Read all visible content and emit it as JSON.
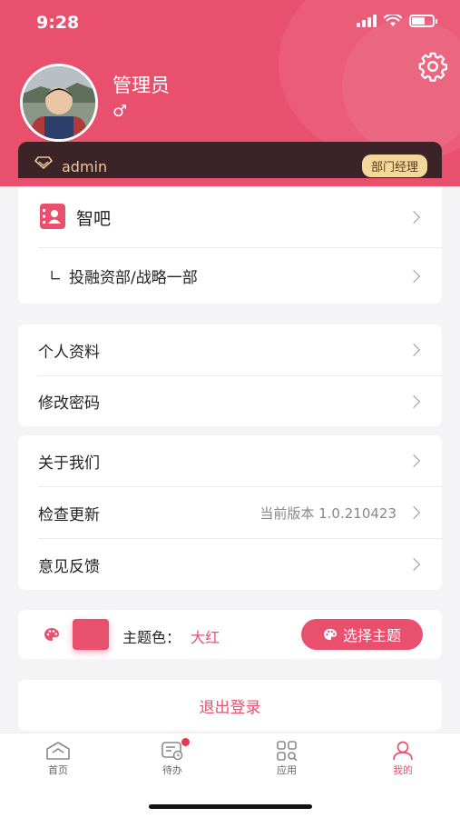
{
  "status_bar": {
    "time": "9:28"
  },
  "profile": {
    "name": "管理员",
    "gender_symbol": "♂"
  },
  "member": {
    "account": "admin",
    "role": "部门经理"
  },
  "org": {
    "title": "智吧",
    "dept_prefix": "∟",
    "dept": "投融资部/战略一部"
  },
  "menu_group1": [
    {
      "label": "个人资料"
    },
    {
      "label": "修改密码"
    }
  ],
  "menu_group2": [
    {
      "label": "关于我们"
    },
    {
      "label": "检查更新",
      "value": "当前版本 1.0.210423"
    },
    {
      "label": "意见反馈"
    }
  ],
  "theme": {
    "label": "主题色：",
    "value": "大红",
    "button": "选择主题",
    "color": "#e9506e"
  },
  "logout_label": "退出登录",
  "tabs": [
    {
      "label": "首页",
      "icon": "home-icon"
    },
    {
      "label": "待办",
      "icon": "todo-icon",
      "badge_dot": true
    },
    {
      "label": "应用",
      "icon": "apps-icon"
    },
    {
      "label": "我的",
      "icon": "user-icon",
      "active": true
    }
  ],
  "colors": {
    "accent": "#e9506e",
    "card_dark": "#3b2327",
    "gold": "#f4d79b"
  }
}
